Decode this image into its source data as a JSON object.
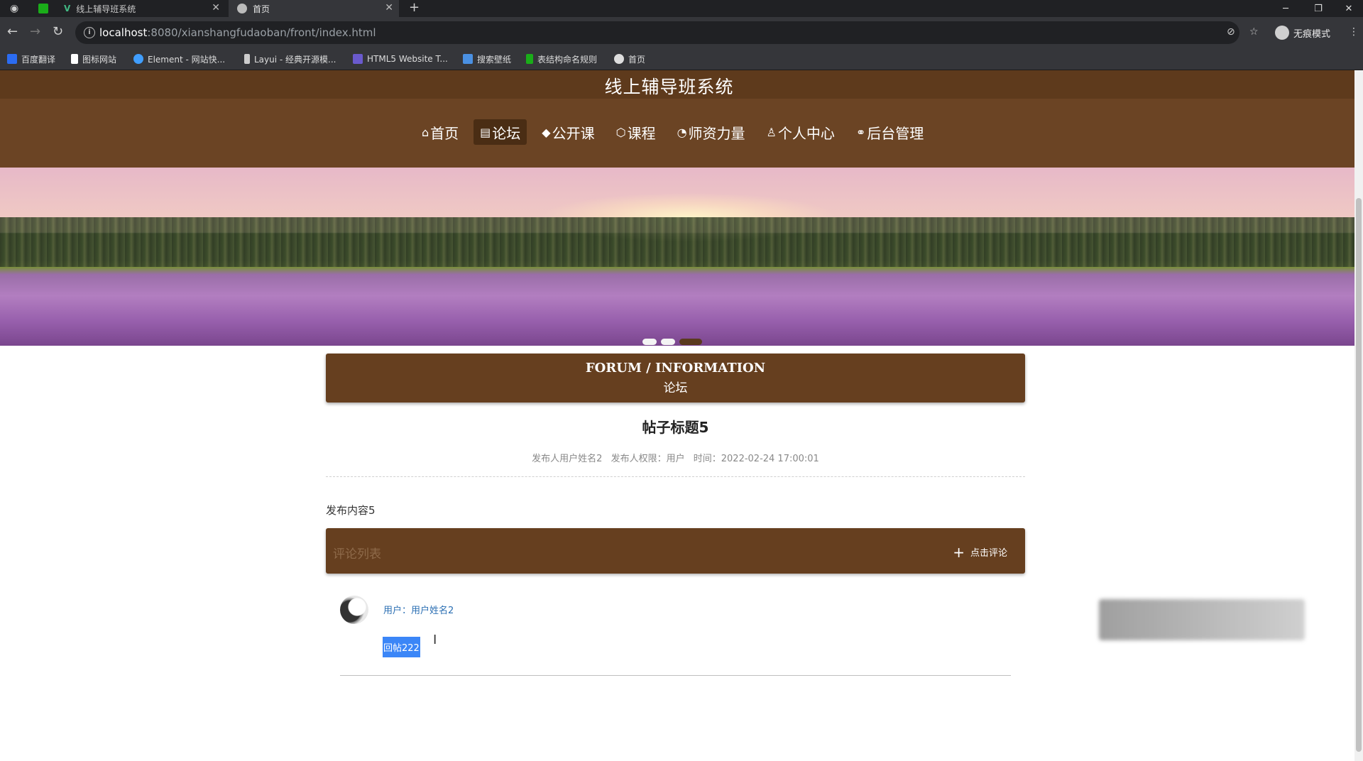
{
  "browser": {
    "tabs": [
      {
        "label": "线上辅导班系统",
        "active": false
      },
      {
        "label": "首页",
        "active": true
      }
    ],
    "new_tab": "+",
    "url_host": "localhost",
    "url_path": ":8080/xianshangfudaoban/front/index.html",
    "incognito_label": "无痕模式",
    "bookmarks": [
      {
        "label": "百度翻译",
        "color": "#2b6cf2"
      },
      {
        "label": "图标网站",
        "color": "#ffffff"
      },
      {
        "label": "Element - 网站快...",
        "color": "#409eff"
      },
      {
        "label": "Layui - 经典开源模...",
        "color": "#cccccc"
      },
      {
        "label": "HTML5 Website T...",
        "color": "#6a5acd"
      },
      {
        "label": "搜索壁纸",
        "color": "#4a90e2"
      },
      {
        "label": "表结构命名规则",
        "color": "#1aad19"
      },
      {
        "label": "首页",
        "color": "#dddddd"
      }
    ]
  },
  "site": {
    "title": "线上辅导班系统",
    "nav": [
      {
        "icon": "⌂",
        "label": "首页",
        "active": false,
        "name": "home"
      },
      {
        "icon": "▤",
        "label": "论坛",
        "active": true,
        "name": "forum"
      },
      {
        "icon": "◆",
        "label": "公开课",
        "active": false,
        "name": "open-course"
      },
      {
        "icon": "⬡",
        "label": "课程",
        "active": false,
        "name": "course"
      },
      {
        "icon": "◔",
        "label": "师资力量",
        "active": false,
        "name": "teachers"
      },
      {
        "icon": "♙",
        "label": "个人中心",
        "active": false,
        "name": "profile"
      },
      {
        "icon": "⚭",
        "label": "后台管理",
        "active": false,
        "name": "admin"
      }
    ],
    "carousel_dots": 3,
    "carousel_active": 2
  },
  "forum": {
    "header_en": "FORUM / INFORMATION",
    "header_cn": "论坛",
    "post_title": "帖子标题5",
    "meta": {
      "author": "发布人用户姓名2",
      "role": "发布人权限：用户",
      "time": "时间：2022-02-24 17:00:01"
    },
    "content": "发布内容5",
    "comment_bar_label": "评论列表",
    "comment_button": "点击评论",
    "comments": [
      {
        "user": "用户：用户姓名2",
        "text": "回帖222"
      }
    ]
  }
}
